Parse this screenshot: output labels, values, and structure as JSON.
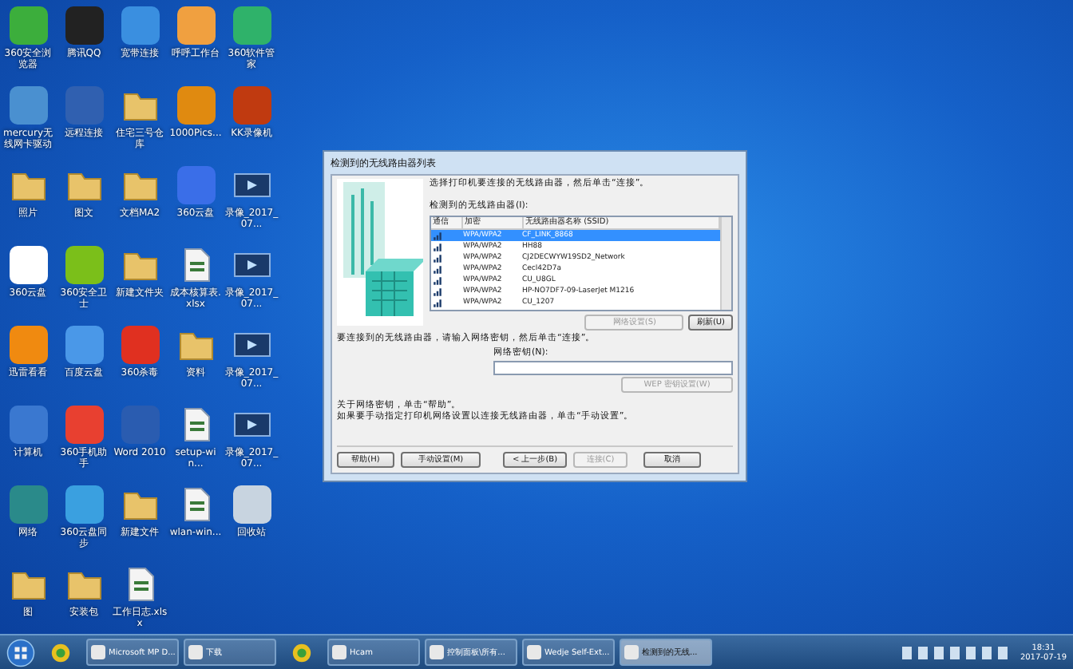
{
  "desktop_icons": [
    {
      "label": "360安全浏览器",
      "kind": "app",
      "color": "#3cae3c"
    },
    {
      "label": "腾讯QQ",
      "kind": "app",
      "color": "#222222"
    },
    {
      "label": "宽带连接",
      "kind": "app",
      "color": "#3a8fe0"
    },
    {
      "label": "呼呼工作台",
      "kind": "app",
      "color": "#f0a040"
    },
    {
      "label": "360软件管家",
      "kind": "app",
      "color": "#2fb26a"
    },
    {
      "label": "mercury无线网卡驱动",
      "kind": "app",
      "color": "#4a90d0"
    },
    {
      "label": "远程连接",
      "kind": "app",
      "color": "#3060b0"
    },
    {
      "label": "住宅三号仓库",
      "kind": "folder"
    },
    {
      "label": "1000Pics...",
      "kind": "app",
      "color": "#e08a10"
    },
    {
      "label": "KK录像机",
      "kind": "app",
      "color": "#c03a10"
    },
    {
      "label": "照片",
      "kind": "folder"
    },
    {
      "label": "图文",
      "kind": "folder"
    },
    {
      "label": "文档MA2",
      "kind": "folder"
    },
    {
      "label": "360云盘",
      "kind": "app",
      "color": "#3a6ee8"
    },
    {
      "label": "录像_2017_07...",
      "kind": "video"
    },
    {
      "label": "360云盘",
      "kind": "app",
      "color": "#ffffff"
    },
    {
      "label": "360安全卫士",
      "kind": "app",
      "color": "#7bbf1a"
    },
    {
      "label": "新建文件夹",
      "kind": "folder"
    },
    {
      "label": "成本核算表.xlsx",
      "kind": "doc"
    },
    {
      "label": "录像_2017_07...",
      "kind": "video"
    },
    {
      "label": "迅雷看看",
      "kind": "app",
      "color": "#f08a10"
    },
    {
      "label": "百度云盘",
      "kind": "app",
      "color": "#4a98e8"
    },
    {
      "label": "360杀毒",
      "kind": "app",
      "color": "#e03020"
    },
    {
      "label": "资料",
      "kind": "folder"
    },
    {
      "label": "录像_2017_07...",
      "kind": "video"
    },
    {
      "label": "计算机",
      "kind": "app",
      "color": "#3a78d0"
    },
    {
      "label": "360手机助手",
      "kind": "app",
      "color": "#e84030"
    },
    {
      "label": "Word 2010",
      "kind": "app",
      "color": "#2a5cb0"
    },
    {
      "label": "setup-win...",
      "kind": "doc"
    },
    {
      "label": "录像_2017_07...",
      "kind": "video"
    },
    {
      "label": "网络",
      "kind": "app",
      "color": "#2a8a8a"
    },
    {
      "label": "360云盘同步",
      "kind": "app",
      "color": "#3aa0e0"
    },
    {
      "label": "新建文件",
      "kind": "folder"
    },
    {
      "label": "wlan-win...",
      "kind": "doc"
    },
    {
      "label": "回收站",
      "kind": "app",
      "color": "#c8d4e0"
    },
    {
      "label": "图",
      "kind": "folder"
    },
    {
      "label": "安装包",
      "kind": "folder"
    },
    {
      "label": "工作日志.xlsx",
      "kind": "doc"
    }
  ],
  "dialog": {
    "title": "检测到的无线路由器列表",
    "instruction": "选择打印机要连接的无线路由器，然后单击“连接”。",
    "list_label": "检测到的无线路由器(I):",
    "columns": [
      "通信",
      "加密",
      "无线路由器名称 (SSID)"
    ],
    "rows": [
      {
        "security": "WPA/WPA2",
        "ssid": "CF_LINK_8868",
        "selected": true
      },
      {
        "security": "WPA/WPA2",
        "ssid": "HH88",
        "selected": false
      },
      {
        "security": "WPA/WPA2",
        "ssid": "CJ2DECWYW19SD2_Network",
        "selected": false
      },
      {
        "security": "WPA/WPA2",
        "ssid": "Cecl42D7a",
        "selected": false
      },
      {
        "security": "WPA/WPA2",
        "ssid": "CU_U8GL",
        "selected": false
      },
      {
        "security": "WPA/WPA2",
        "ssid": "HP-NO7DF7-09-LaserJet M1216",
        "selected": false
      },
      {
        "security": "WPA/WPA2",
        "ssid": "CU_1207",
        "selected": false
      }
    ],
    "list_buttons": [
      {
        "label": "网络设置(S)",
        "disabled": true
      },
      {
        "label": "刷新(U)",
        "disabled": false
      }
    ],
    "key_instruction": "要连接到的无线路由器，请输入网络密钥，然后单击“连接”。",
    "key_label": "网络密钥(N):",
    "wep_button": {
      "label": "WEP 密钥设置(W)",
      "disabled": true
    },
    "notes": [
      "关于网络密钥，单击“帮助”。",
      "如果要手动指定打印机网络设置以连接无线路由器，单击“手动设置”。"
    ],
    "buttons": [
      {
        "label": "帮助(H)",
        "disabled": false
      },
      {
        "label": "手动设置(M)",
        "disabled": false
      },
      {
        "label": "< 上一步(B)",
        "disabled": false
      },
      {
        "label": "连接(C)",
        "disabled": true
      },
      {
        "label": "取消",
        "disabled": false
      }
    ]
  },
  "taskbar": {
    "items": [
      {
        "kind": "pinned"
      },
      {
        "label": "Microsoft MP D...",
        "kind": "window",
        "selected": false
      },
      {
        "label": "下载",
        "kind": "window",
        "selected": false
      },
      {
        "kind": "pinned"
      },
      {
        "label": "Hcam",
        "kind": "window",
        "selected": false
      },
      {
        "label": "控制面板\\所有...",
        "kind": "window",
        "selected": false
      },
      {
        "label": "Wedje Self-Ext...",
        "kind": "window",
        "selected": false
      },
      {
        "label": "检测到的无线...",
        "kind": "window",
        "selected": true
      }
    ],
    "time": "18:31",
    "date": "2017-07-19"
  }
}
